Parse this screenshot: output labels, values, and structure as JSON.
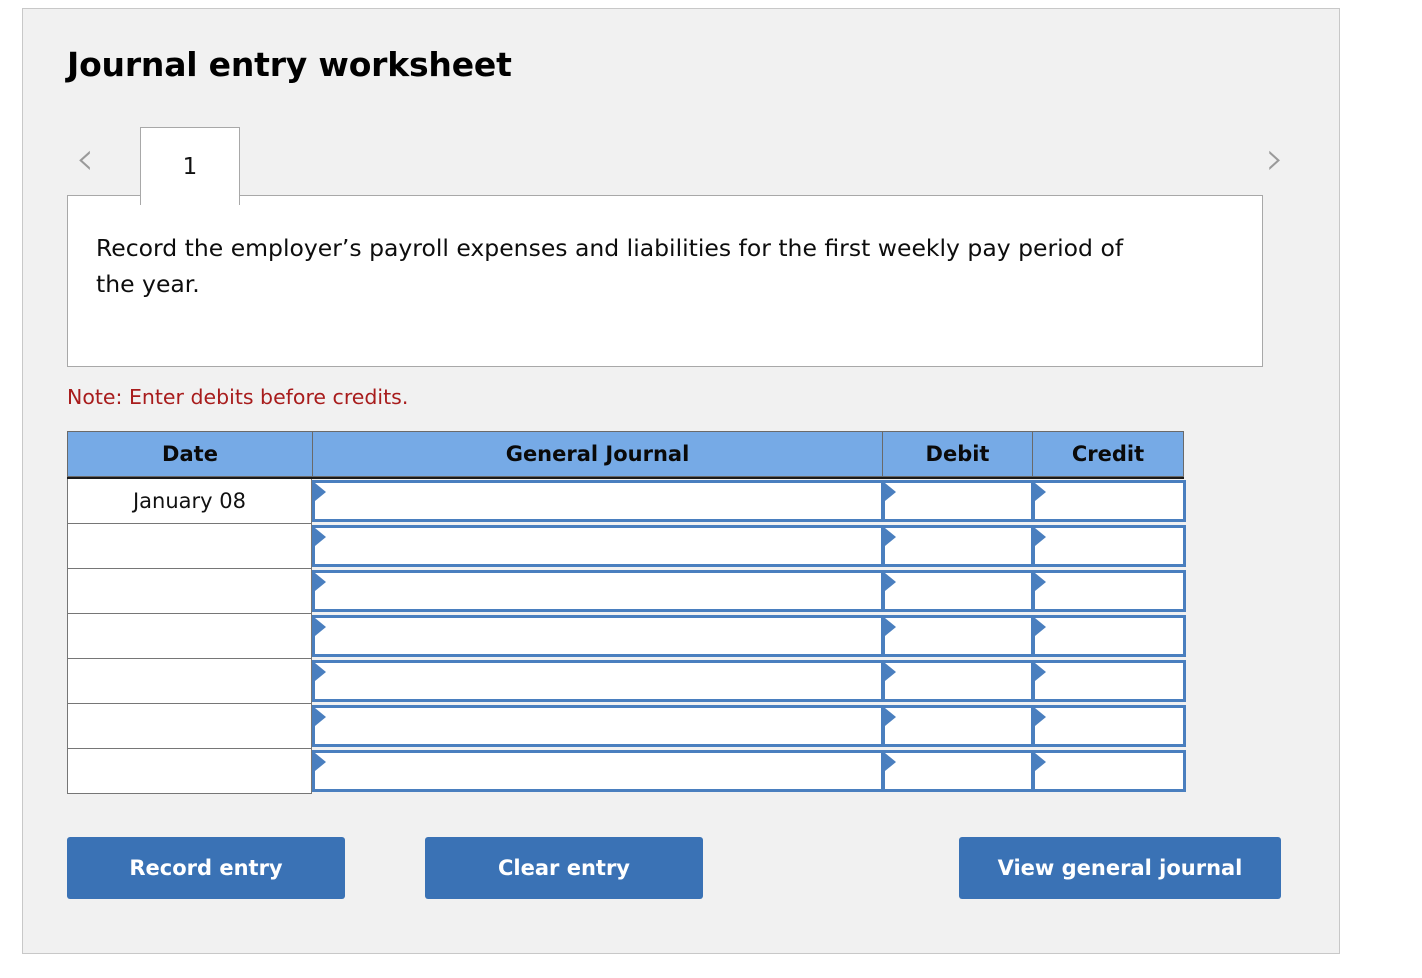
{
  "page_title": "Journal entry worksheet",
  "nav": {
    "prev_icon": "chevron-left-icon",
    "next_icon": "chevron-right-icon",
    "prev_label": "‹",
    "next_label": "›"
  },
  "tabs": [
    {
      "label": "1",
      "active": true
    }
  ],
  "instruction": "Record the employer’s payroll expenses and liabilities for the first weekly pay period of the year.",
  "note": "Note: Enter debits before credits.",
  "table": {
    "columns": [
      "Date",
      "General Journal",
      "Debit",
      "Credit"
    ],
    "rows": [
      {
        "date": "January 08",
        "general_journal": "",
        "debit": "",
        "credit": ""
      },
      {
        "date": "",
        "general_journal": "",
        "debit": "",
        "credit": ""
      },
      {
        "date": "",
        "general_journal": "",
        "debit": "",
        "credit": ""
      },
      {
        "date": "",
        "general_journal": "",
        "debit": "",
        "credit": ""
      },
      {
        "date": "",
        "general_journal": "",
        "debit": "",
        "credit": ""
      },
      {
        "date": "",
        "general_journal": "",
        "debit": "",
        "credit": ""
      },
      {
        "date": "",
        "general_journal": "",
        "debit": "",
        "credit": ""
      }
    ]
  },
  "buttons": {
    "record": "Record entry",
    "clear": "Clear entry",
    "view": "View general journal"
  },
  "colors": {
    "panel_bg": "#f1f1f1",
    "header_blue": "#76aae6",
    "input_border_blue": "#4a7fbf",
    "button_blue": "#3a72b5",
    "note_red": "#a81c1c"
  }
}
